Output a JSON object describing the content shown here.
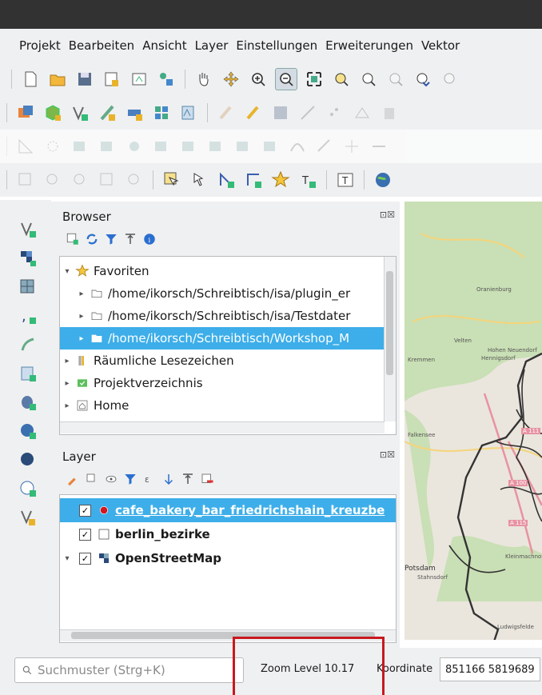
{
  "menu": [
    "Projekt",
    "Bearbeiten",
    "Ansicht",
    "Layer",
    "Einstellungen",
    "Erweiterungen",
    "Vektor"
  ],
  "browser": {
    "title": "Browser",
    "controls": "⊡☒",
    "items": [
      {
        "label": "Favoriten",
        "arrow": "▾"
      },
      {
        "label": "/home/ikorsch/Schreibtisch/isa/plugin_er",
        "arrow": "▸"
      },
      {
        "label": "/home/ikorsch/Schreibtisch/isa/Testdater",
        "arrow": "▸"
      },
      {
        "label": "/home/ikorsch/Schreibtisch/Workshop_M",
        "arrow": "▸"
      },
      {
        "label": "Räumliche Lesezeichen",
        "arrow": "▸"
      },
      {
        "label": "Projektverzeichnis",
        "arrow": "▸"
      },
      {
        "label": "Home",
        "arrow": "▸"
      }
    ]
  },
  "layers": {
    "title": "Layer",
    "controls": "⊡☒",
    "items": [
      {
        "label": "cafe_bakery_bar_friedrichshain_kreuzbe",
        "checked": "✓"
      },
      {
        "label": "berlin_bezirke",
        "checked": "✓"
      },
      {
        "label": "OpenStreetMap",
        "checked": "✓",
        "arrow": "▾"
      }
    ]
  },
  "status": {
    "search_placeholder": "Suchmuster (Strg+K)",
    "zoom": "Zoom Level 10.17",
    "coord_label": "Koordinate",
    "coord_value": "851166 5819689"
  },
  "map_labels": [
    "Oranienburg",
    "Velten",
    "Hohen Neuendorf",
    "Hennigsdorf",
    "Falkensee",
    "Potsdam",
    "Stahnsdorf",
    "A 111",
    "A 100",
    "A 115",
    "Kremmen",
    "Ludwigsfelde",
    "Kleinmachnow"
  ],
  "colors": {
    "selection": "#3daee9",
    "highlight": "#c8191e",
    "boundary": "#333333",
    "forest": "#add19e"
  }
}
